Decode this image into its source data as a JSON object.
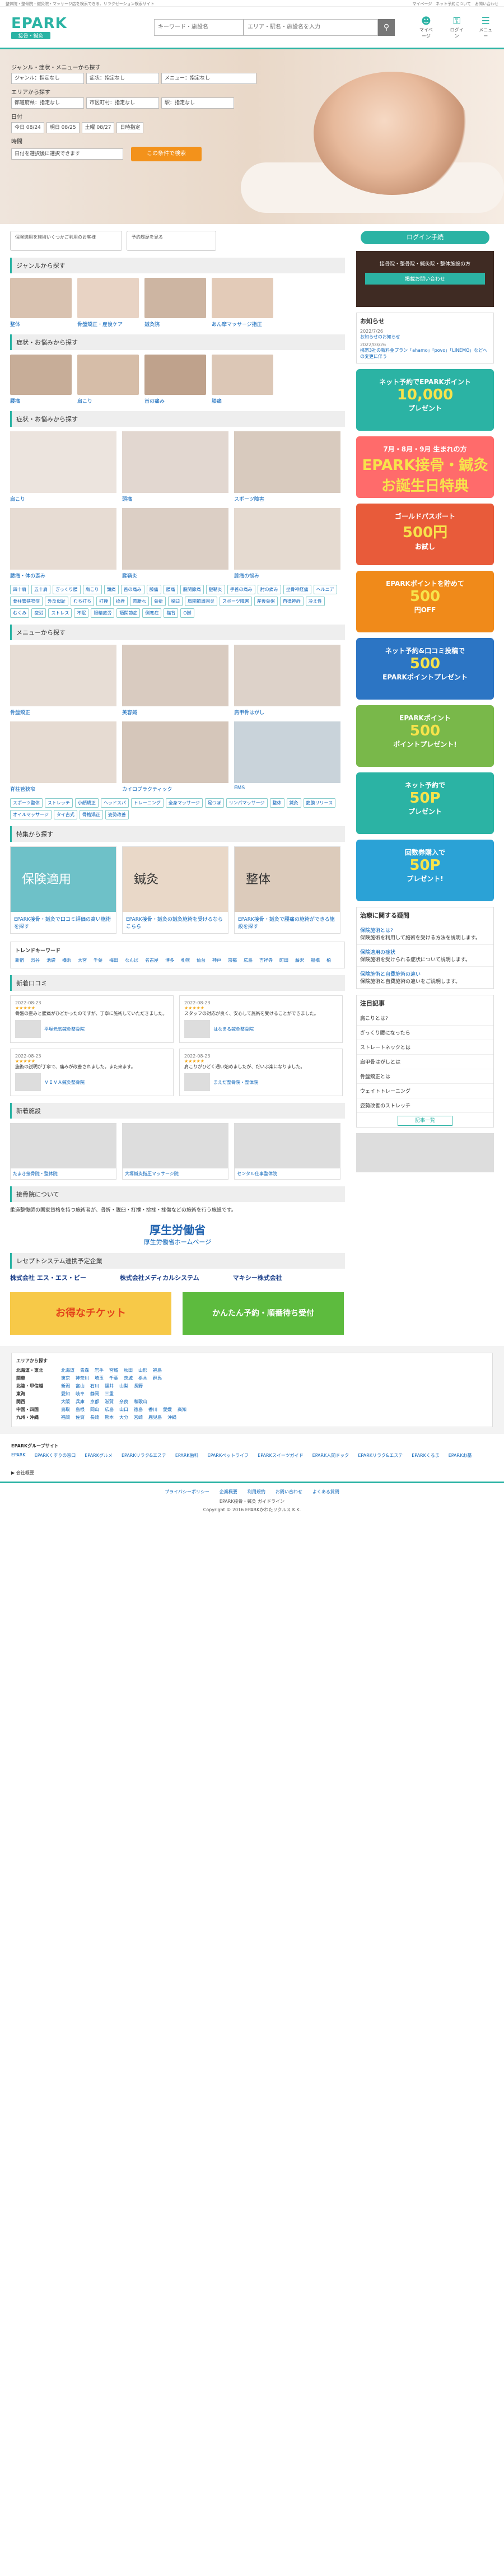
{
  "topbar": {
    "left": "整体院・整骨院・鍼灸院・マッサージ店を検索できる、リラクゼーション検索サイト",
    "right": "マイページ　ネット予約について　お問い合わせ"
  },
  "header": {
    "logo": "EPARK",
    "sub": "接骨・鍼灸",
    "kw_placeholder": "キーワード・施設名",
    "area_placeholder": "エリア・駅名・施設名を入力",
    "icons": [
      {
        "name": "マイページ",
        "icon": "person"
      },
      {
        "name": "ログイン",
        "icon": "key"
      },
      {
        "name": "メニュー",
        "icon": "menu"
      }
    ]
  },
  "hero": {
    "genre_label": "ジャンル・症状・メニューから探す",
    "genre_sel": [
      "ジャンル：指定なし",
      "症状：指定なし",
      "メニュー：指定なし"
    ],
    "area_label": "エリアから探す",
    "area_sel": [
      "都道府県：指定なし",
      "市区町村：指定なし",
      "駅：指定なし"
    ],
    "date_label": "日付",
    "dates": [
      "今日 08/24",
      "明日 08/25",
      "土曜 08/27",
      "日時指定"
    ],
    "time_label": "時間",
    "time_sel": "日付を選択後に選択できます",
    "search": "この条件で検索"
  },
  "side": {
    "login": "ログイン手続",
    "ad": "接骨院・整骨院・鍼灸院・整体施設の方",
    "ad2": "掲載お問い合わせ",
    "news_title": "お知らせ",
    "news": [
      {
        "d": "2022/7/26",
        "t": "お知らせのお知らせ"
      },
      {
        "d": "2022/03/26",
        "t": "携帯3社の新料金プラン「ahamo」「povo」「LINEMO」などへの変更に伴う"
      }
    ],
    "banners": [
      {
        "t": "ネット予約でEPARKポイント",
        "n": "10,000",
        "s": "プレゼント",
        "bg": "#2bb3a4"
      },
      {
        "t": "7月・8月・9月 生まれの方",
        "n": "EPARK接骨・鍼灸 お誕生日特典",
        "s": "",
        "bg": "#ff6b6b"
      },
      {
        "t": "ゴールドパスポート",
        "n": "500円",
        "s": "お試し",
        "bg": "#e85b3a"
      },
      {
        "t": "EPARKポイントを貯めて",
        "n": "500",
        "s": "円OFF",
        "bg": "#f08a1a"
      },
      {
        "t": "ネット予約&口コミ投稿で",
        "n": "500",
        "s": "EPARKポイントプレゼント",
        "bg": "#2c75c4"
      },
      {
        "t": "EPARKポイント",
        "n": "500",
        "s": "ポイントプレゼント!",
        "bg": "#79b84a"
      },
      {
        "t": "ネット予約で",
        "n": "50P",
        "s": "プレゼント",
        "bg": "#2bb3a4"
      },
      {
        "t": "回数券購入で",
        "n": "50P",
        "s": "プレゼント!",
        "bg": "#2ba2d6"
      }
    ],
    "faq_title": "治療に関する疑問",
    "faq": [
      {
        "q": "保険施術とは?",
        "a": "保険施術を利用して施術を受ける方法を説明します。"
      },
      {
        "q": "保険適用の症状",
        "a": "保険施術を受けられる症状について説明します。"
      },
      {
        "q": "保険施術と自費施術の違い",
        "a": "保険施術と自費施術の違いをご説明します。"
      }
    ],
    "att_title": "注目記事",
    "att": [
      "肩こりとは?",
      "ぎっくり腰になったら",
      "ストレートネックとは",
      "肩甲骨はがしとは",
      "骨盤矯正とは",
      "ウェイトトレーニング",
      "姿勢改善のストレッチ"
    ],
    "more": "記事一覧"
  },
  "main": {
    "notice": [
      "保険適用を施術いくつかご利用のお客様",
      "予約履歴を見る"
    ],
    "genre_h": "ジャンルから探す",
    "genre": [
      "整体",
      "骨盤矯正・産後ケア",
      "鍼灸院",
      "あん摩マッサージ指圧"
    ],
    "sym_h": "症状・お悩みから探す",
    "sym": [
      "腰痛",
      "肩こり",
      "首の痛み",
      "膝痛"
    ],
    "pain_h": "症状・お悩みから探す",
    "pain": [
      "肩こり",
      "頭痛",
      "スポーツ障害",
      "腰痛・体の歪み",
      "腱鞘炎",
      "膝痛の悩み"
    ],
    "tags": [
      "四十肩",
      "五十肩",
      "ぎっくり腰",
      "肩こり",
      "頭痛",
      "首の痛み",
      "膝痛",
      "腰痛",
      "股関節痛",
      "腱鞘炎",
      "手首の痛み",
      "肘の痛み",
      "坐骨神経痛",
      "ヘルニア",
      "脊柱管狭窄症",
      "外反母趾",
      "むち打ち",
      "打撲",
      "捻挫",
      "肉離れ",
      "骨折",
      "脱臼",
      "肩関節周囲炎",
      "スポーツ障害",
      "産後骨盤",
      "自律神経",
      "冷え性",
      "むくみ",
      "疲労",
      "ストレス",
      "不眠",
      "眼精疲労",
      "顎関節症",
      "側弯症",
      "猫背",
      "O脚"
    ],
    "menu_h": "メニューから探す",
    "menu": [
      "骨盤矯正",
      "美容鍼",
      "肩甲骨はがし",
      "脊柱管狭窄",
      "カイロプラクティック",
      "EMS"
    ],
    "menu_tags": [
      "スポーツ整体",
      "ストレッチ",
      "小顔矯正",
      "ヘッドスパ",
      "トレーニング",
      "全身マッサージ",
      "足つぼ",
      "リンパマッサージ",
      "整体",
      "鍼灸",
      "筋膜リリース",
      "オイルマッサージ",
      "タイ古式",
      "骨格矯正",
      "姿勢改善"
    ],
    "feat_h": "特集から探す",
    "feat": [
      {
        "b": "保険適用",
        "cap": "EPARK接骨・鍼灸で口コミ評価の高い施術を探す"
      },
      {
        "b": "鍼灸",
        "cap": "EPARK接骨・鍼灸の鍼灸施術を受けるならこちら"
      },
      {
        "b": "整体",
        "cap": "EPARK接骨・鍼灸で腰痛の施術ができる施設を探す"
      }
    ],
    "trend_h": "トレンドキーワード",
    "trend": [
      "新宿",
      "渋谷",
      "池袋",
      "横浜",
      "大宮",
      "千葉",
      "梅田",
      "なんば",
      "名古屋",
      "博多",
      "札幌",
      "仙台",
      "神戸",
      "京都",
      "広島",
      "吉祥寺",
      "町田",
      "藤沢",
      "船橋",
      "柏"
    ],
    "rev_h": "新着口コミ",
    "revs": [
      {
        "d": "2022-08-23",
        "st": "★★★★★",
        "t": "骨盤の歪みと腰痛がひどかったのですが、丁寧に施術していただきました。",
        "s": "平塚元気鍼灸整骨院"
      },
      {
        "d": "2022-08-23",
        "st": "★★★★★",
        "t": "スタッフの対応が良く、安心して施術を受けることができました。",
        "s": "はなまる鍼灸整骨院"
      },
      {
        "d": "2022-08-23",
        "st": "★★★★★",
        "t": "施術の説明が丁寧で、痛みが改善されました。また来ます。",
        "s": "ＶＩＶＡ鍼灸整骨院"
      },
      {
        "d": "2022-08-23",
        "st": "★★★★★",
        "t": "肩こりがひどく通い始めましたが、だいぶ楽になりました。",
        "s": "まえだ整骨院・整体院"
      }
    ],
    "news_h": "新着施設",
    "newsitems": [
      {
        "t": "たまき接骨院・整体院"
      },
      {
        "t": "大塚鍼灸指圧マッサージ院"
      },
      {
        "t": "センタル仕事整体院"
      }
    ],
    "about_h": "接骨院について",
    "about": "柔道整復師の国家資格を持つ施術者が、骨折・脱臼・打撲・捻挫・挫傷などの施術を行う施設です。",
    "mhlw": "厚生労働省",
    "mhlw_link": "厚生労働省ホームページ",
    "partners_h": "レセプトシステム連携予定企業",
    "partners": [
      "株式会社 エス・エス・ビー",
      "株式会社メディカルシステム",
      "マキシー株式会社"
    ],
    "promo": [
      "お得なチケット",
      "かんたん予約・順番待ち受付"
    ]
  },
  "footer": {
    "area_h": "エリアから探す",
    "rows": [
      {
        "k": "北海道・東北",
        "v": [
          "北海道",
          "青森",
          "岩手",
          "宮城",
          "秋田",
          "山形",
          "福島"
        ]
      },
      {
        "k": "関東",
        "v": [
          "東京",
          "神奈川",
          "埼玉",
          "千葉",
          "茨城",
          "栃木",
          "群馬"
        ]
      },
      {
        "k": "北陸・甲信越",
        "v": [
          "新潟",
          "富山",
          "石川",
          "福井",
          "山梨",
          "長野"
        ]
      },
      {
        "k": "東海",
        "v": [
          "愛知",
          "岐阜",
          "静岡",
          "三重"
        ]
      },
      {
        "k": "関西",
        "v": [
          "大阪",
          "兵庫",
          "京都",
          "滋賀",
          "奈良",
          "和歌山"
        ]
      },
      {
        "k": "中国・四国",
        "v": [
          "鳥取",
          "島根",
          "岡山",
          "広島",
          "山口",
          "徳島",
          "香川",
          "愛媛",
          "高知"
        ]
      },
      {
        "k": "九州・沖縄",
        "v": [
          "福岡",
          "佐賀",
          "長崎",
          "熊本",
          "大分",
          "宮崎",
          "鹿児島",
          "沖縄"
        ]
      }
    ],
    "group_h": "EPARKグループサイト",
    "group": [
      "EPARK",
      "EPARKくすりの窓口",
      "EPARKグルメ",
      "EPARKリラク&エステ",
      "EPARK歯科",
      "EPARKペットライフ",
      "EPARKスイーツガイド",
      "EPARK人間ドック",
      "EPARKリラク&エステ",
      "EPARKくるま",
      "EPARKお墓"
    ],
    "about": "▶ 会社概要",
    "links": [
      "プライバシーポリシー",
      "企業概要",
      "利用規約",
      "お問い合わせ",
      "よくある質問"
    ],
    "guide": "EPARK接骨・鍼灸 ガイドライン",
    "copy": "Copyright © 2016 EPARKかわたリクルス K.K."
  }
}
